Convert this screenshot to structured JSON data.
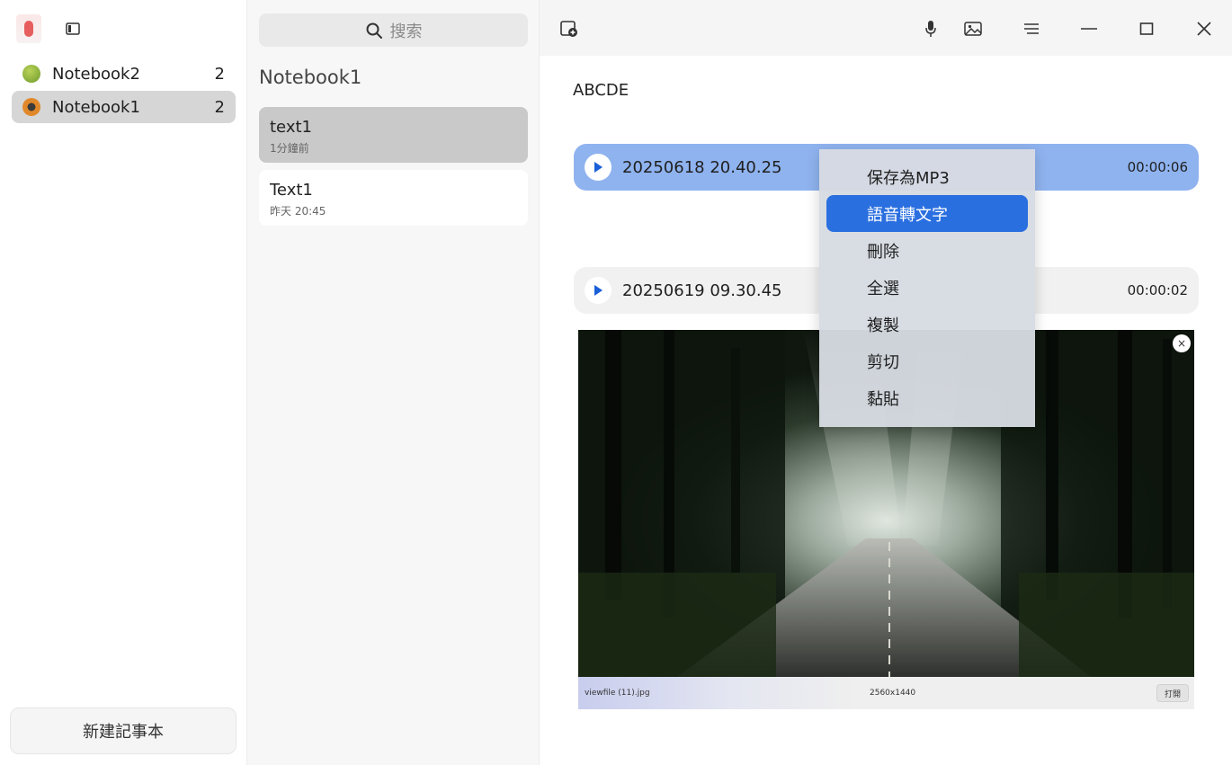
{
  "sidebar": {
    "notebooks": [
      {
        "label": "Notebook2",
        "count": "2",
        "color": "#8cb33a"
      },
      {
        "label": "Notebook1",
        "count": "2",
        "color": "#e0882a"
      }
    ],
    "new_note_label": "新建記事本"
  },
  "notes_panel": {
    "search_placeholder": "搜索",
    "notebook_title": "Notebook1",
    "notes": [
      {
        "title": "text1",
        "time": "1分鐘前"
      },
      {
        "title": "Text1",
        "time": "昨天 20:45"
      }
    ]
  },
  "editor": {
    "body_text": "ABCDE",
    "audio_clips": [
      {
        "name": "20250618 20.40.25",
        "duration": "00:00:06"
      },
      {
        "name": "20250619 09.30.45",
        "duration": "00:00:02"
      }
    ],
    "image": {
      "filename": "viewfile (11).jpg",
      "resolution": "2560x1440",
      "open_label": "打開",
      "close_glyph": "×"
    }
  },
  "context_menu": {
    "items": [
      "保存為MP3",
      "語音轉文字",
      "刪除",
      "全選",
      "複製",
      "剪切",
      "黏貼"
    ],
    "highlighted_index": 1
  },
  "colors": {
    "accent": "#2a6fe0",
    "selected_audio": "#8fb3ef"
  }
}
